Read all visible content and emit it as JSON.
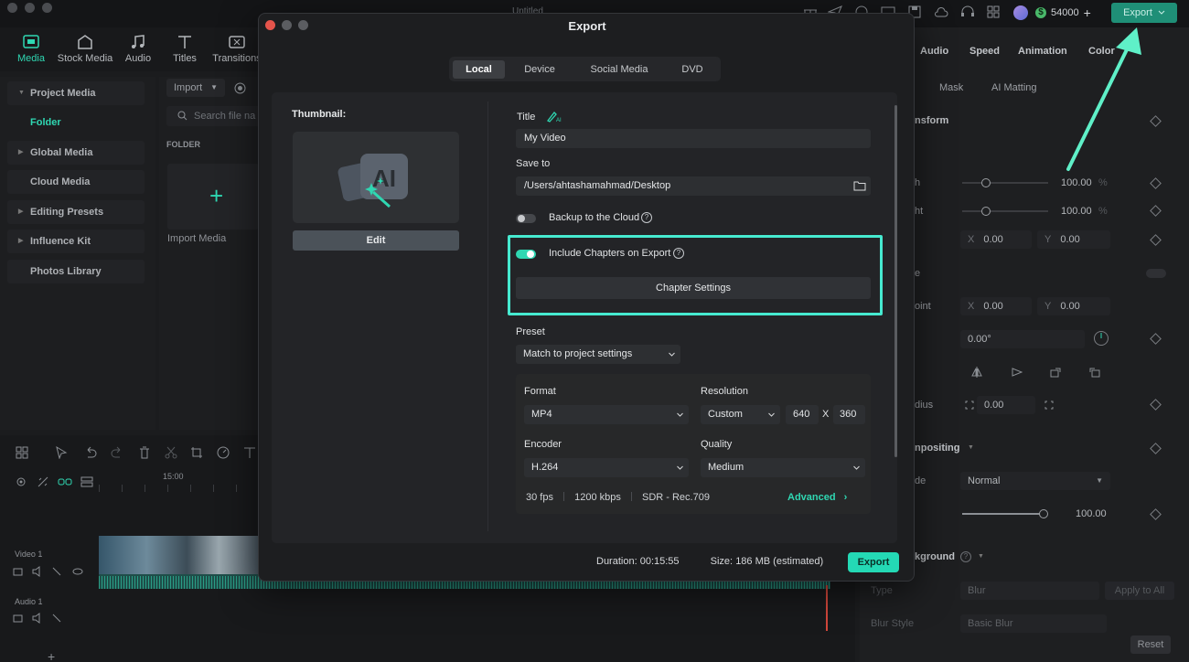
{
  "app": {
    "window_title": "Untitled",
    "credits": "54000",
    "export_label": "Export"
  },
  "media_tabs": [
    "Media",
    "Stock Media",
    "Audio",
    "Titles",
    "Transitions"
  ],
  "media_sidebar": [
    "Project Media",
    "Folder",
    "Global Media",
    "Cloud Media",
    "Editing Presets",
    "Influence Kit",
    "Photos Library"
  ],
  "media_panel": {
    "import_label": "Import",
    "search_placeholder": "Search file na",
    "folder_label": "FOLDER",
    "import_media_label": "Import Media"
  },
  "timeline": {
    "time_marker": "15:00",
    "video_track": "Video 1",
    "audio_track": "Audio 1"
  },
  "inspector": {
    "tabs": [
      "Audio",
      "Speed",
      "Animation",
      "Color"
    ],
    "subtabs": [
      "Mask",
      "AI Matting"
    ],
    "section_transform": "nsform",
    "scale_w_label": "h",
    "scale_h_label": "ht",
    "scale_w_value": "100.00",
    "scale_h_value": "100.00",
    "percent": "%",
    "pos_x_label": "X",
    "pos_x_value": "0.00",
    "pos_y_label": "Y",
    "pos_y_value": "0.00",
    "row_e_label": "e",
    "anchor_label": "oint",
    "anchor_x_value": "0.00",
    "anchor_y_value": "0.00",
    "rotate_value": "0.00°",
    "radius_label": "dius",
    "radius_value": "0.00",
    "section_compositing": "npositing",
    "blend_label": "de",
    "blend_value": "Normal",
    "opacity_value": "100.00",
    "section_background": "kground",
    "type_label": "Type",
    "type_value": "Blur",
    "apply_all": "Apply to All",
    "blur_style_label": "Blur Style",
    "blur_style_value": "Basic Blur",
    "reset": "Reset"
  },
  "dialog": {
    "title": "Export",
    "tabs": [
      "Local",
      "Device",
      "Social Media",
      "DVD"
    ],
    "active_tab": "Local",
    "thumbnail_label": "Thumbnail:",
    "edit_label": "Edit",
    "title_label": "Title",
    "title_value": "My Video",
    "save_to_label": "Save to",
    "save_to_value": "/Users/ahtashamahmad/Desktop",
    "backup_label": "Backup to the Cloud",
    "backup_on": false,
    "chapters_label": "Include Chapters on Export",
    "chapters_on": true,
    "chapter_settings_label": "Chapter Settings",
    "preset_label": "Preset",
    "preset_value": "Match to project settings",
    "format_label": "Format",
    "format_value": "MP4",
    "resolution_label": "Resolution",
    "resolution_value": "Custom",
    "res_width": "640",
    "res_x": "X",
    "res_height": "360",
    "encoder_label": "Encoder",
    "encoder_value": "H.264",
    "quality_label": "Quality",
    "quality_value": "Medium",
    "fps": "30 fps",
    "bitrate": "1200 kbps",
    "color_space": "SDR - Rec.709",
    "advanced_label": "Advanced",
    "duration_label": "Duration:",
    "duration_value": "00:15:55",
    "size_label": "Size:",
    "size_value": "186 MB",
    "size_note": "(estimated)",
    "export_label": "Export"
  },
  "colors": {
    "accent": "#2fd7b2",
    "highlight": "#46ead0",
    "export_button": "#24d9b5",
    "close_dot": "#e5544b"
  }
}
